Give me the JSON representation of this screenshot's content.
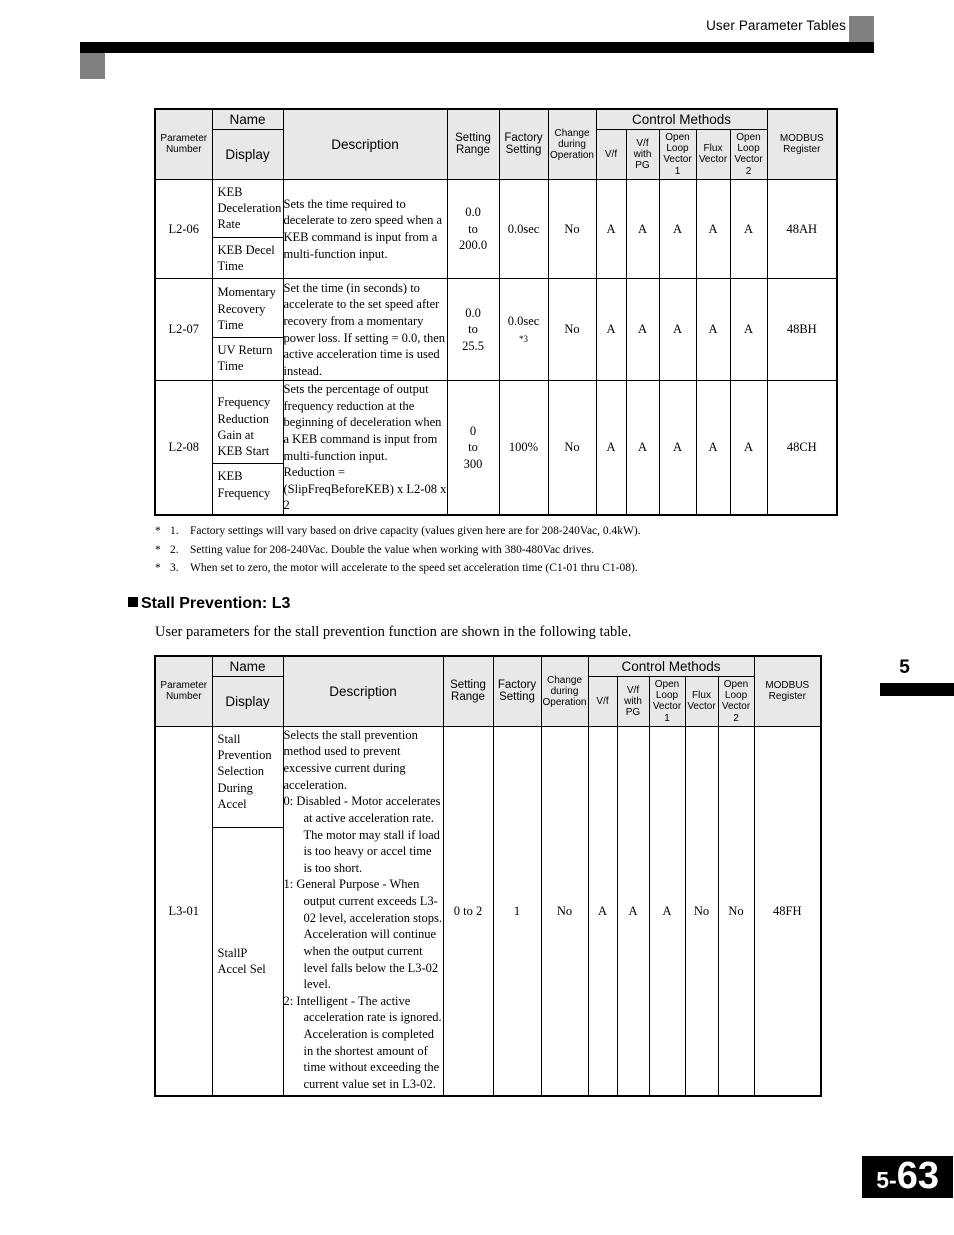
{
  "header": {
    "title": "User Parameter Tables"
  },
  "chapter_marker": {
    "number": "5"
  },
  "footer": {
    "chapter": "5",
    "separator": "-",
    "page": "63"
  },
  "table_columns": {
    "parameter_number": "Parameter\nNumber",
    "name": "Name",
    "display": "Display",
    "description": "Description",
    "setting_range": "Setting\nRange",
    "factory_setting": "Factory\nSetting",
    "change_during_operation": "Change\nduring\nOperation",
    "control_methods": "Control Methods",
    "vf": "V/f",
    "vf_with_pg": "V/f\nwith\nPG",
    "open_loop_vector_1": "Open\nLoop\nVector\n1",
    "flux_vector": "Flux\nVector",
    "open_loop_vector_2": "Open\nLoop\nVector\n2",
    "modbus_register": "MODBUS\nRegister"
  },
  "header_labels": {
    "parameter_number_l1": "Parameter",
    "parameter_number_l2": "Number",
    "name": "Name",
    "display": "Display",
    "description": "Description",
    "setting_l1": "Setting",
    "setting_l2": "Range",
    "factory_l1": "Factory",
    "factory_l2": "Setting",
    "change_l1": "Change",
    "change_l2": "during",
    "change_l3": "Operation",
    "control_methods": "Control Methods",
    "vf": "V/f",
    "vfpg_l1": "V/f",
    "vfpg_l2": "with",
    "vfpg_l3": "PG",
    "olv1_l1": "Open",
    "olv1_l2": "Loop",
    "olv1_l3": "Vector",
    "olv1_l4": "1",
    "flux_l1": "Flux",
    "flux_l2": "Vector",
    "olv2_l1": "Open",
    "olv2_l2": "Loop",
    "olv2_l3": "Vector",
    "olv2_l4": "2",
    "modbus_l1": "MODBUS",
    "modbus_l2": "Register"
  },
  "table1": {
    "rows": [
      {
        "parameter_number": "L2-06",
        "name_top": "KEB\nDeceleration\nRate",
        "name_bottom": "KEB Decel\nTime",
        "description": "Sets the time required to decelerate to zero speed when a KEB command is input from a multi-function input.",
        "setting_range": "0.0\nto\n200.0",
        "factory_setting": "0.0sec",
        "factory_setting_note": "",
        "change_during_operation": "No",
        "vf": "A",
        "vf_with_pg": "A",
        "open_loop_vector_1": "A",
        "flux_vector": "A",
        "open_loop_vector_2": "A",
        "modbus_register": "48AH"
      },
      {
        "parameter_number": "L2-07",
        "name_top": "Momentary\nRecovery\nTime",
        "name_bottom": "UV Return\nTime",
        "description": "Set the time (in seconds) to accelerate to the set speed after recovery from a momentary power loss. If setting = 0.0, then active acceleration time is used instead.",
        "setting_range": "0.0\nto\n25.5",
        "factory_setting": "0.0sec",
        "factory_setting_note": "*3",
        "change_during_operation": "No",
        "vf": "A",
        "vf_with_pg": "A",
        "open_loop_vector_1": "A",
        "flux_vector": "A",
        "open_loop_vector_2": "A",
        "modbus_register": "48BH"
      },
      {
        "parameter_number": "L2-08",
        "name_top": "Frequency\nReduction\nGain at\nKEB Start",
        "name_bottom": "KEB\nFrequency",
        "description": "Sets the percentage of output frequency reduction at the beginning of deceleration when a KEB command is input from multi-function input.",
        "description_line2": "Reduction = (SlipFreqBeforeKEB) x L2-08 x  2",
        "setting_range": "0\nto\n300",
        "factory_setting": "100%",
        "factory_setting_note": "",
        "change_during_operation": "No",
        "vf": "A",
        "vf_with_pg": "A",
        "open_loop_vector_1": "A",
        "flux_vector": "A",
        "open_loop_vector_2": "A",
        "modbus_register": "48CH"
      }
    ]
  },
  "footnotes": [
    {
      "star": "*",
      "number": "1.",
      "text": "Factory settings will vary based on drive capacity (values given here are for 208-240Vac, 0.4kW)."
    },
    {
      "star": "*",
      "number": "2.",
      "text": "Setting value for 208-240Vac.  Double the value when working with 380-480Vac drives."
    },
    {
      "star": "*",
      "number": "3.",
      "text": "When set to zero, the motor will accelerate to the speed set acceleration time (C1-01 thru C1-08)."
    }
  ],
  "section": {
    "heading": "Stall Prevention: L3",
    "intro": "User parameters for the stall prevention function are shown in the following table."
  },
  "table2": {
    "rows": [
      {
        "parameter_number": "L3-01",
        "name_top": "Stall\nPrevention\nSelection\nDuring\nAccel",
        "name_bottom": "StallP\nAccel Sel",
        "description_intro": "Selects the stall prevention method used to prevent excessive current during acceleration.",
        "description_items": [
          "0: Disabled - Motor accelerates at active acceleration rate. The motor may stall if load is too heavy or accel time is too short.",
          "1: General Purpose - When output current exceeds L3-02 level, acceleration stops. Acceleration will continue when the output current level falls below the L3-02 level.",
          "2: Intelligent - The active acceleration rate is ignored. Acceleration is completed in the shortest amount of time without exceeding the current value set in L3-02."
        ],
        "setting_range": "0 to 2",
        "factory_setting": "1",
        "change_during_operation": "No",
        "vf": "A",
        "vf_with_pg": "A",
        "open_loop_vector_1": "A",
        "flux_vector": "No",
        "open_loop_vector_2": "No",
        "modbus_register": "48FH"
      }
    ]
  }
}
